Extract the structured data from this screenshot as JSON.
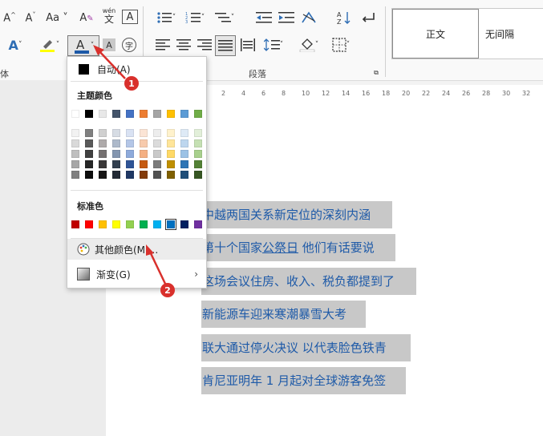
{
  "ribbon": {
    "row1_icons": [
      "A^",
      "A˅",
      "Aa",
      "A✎",
      "wén",
      "A"
    ],
    "wen_top": "wén",
    "wen_bottom": "文",
    "group_font_tail": "体",
    "group_paragraph": "段落",
    "styles": [
      "正文",
      "无间隔"
    ]
  },
  "ruler_ticks": [
    "2",
    "4",
    "6",
    "8",
    "10",
    "12",
    "14",
    "16",
    "18",
    "20",
    "22",
    "24",
    "26",
    "28",
    "30",
    "32"
  ],
  "menu": {
    "auto_label": "自动(A)",
    "theme_title": "主题颜色",
    "standard_title": "标准色",
    "more_colors": "其他颜色(M)...",
    "gradient": "渐变(G)"
  },
  "theme_top": [
    "#ffffff",
    "#000000",
    "#e8e8e8",
    "#44546a",
    "#4472c4",
    "#ed7d31",
    "#a5a5a5",
    "#ffc000",
    "#5b9bd5",
    "#70ad47"
  ],
  "theme_shades": [
    [
      "#f2f2f2",
      "#d9d9d9",
      "#bfbfbf",
      "#a6a6a6",
      "#808080"
    ],
    [
      "#808080",
      "#595959",
      "#404040",
      "#262626",
      "#0d0d0d"
    ],
    [
      "#d0d0d0",
      "#aeaaaa",
      "#757171",
      "#3a3838",
      "#171616"
    ],
    [
      "#d6dce4",
      "#adb9ca",
      "#8496b0",
      "#323f4f",
      "#222a35"
    ],
    [
      "#d9e2f3",
      "#b4c6e7",
      "#8eaadb",
      "#2f5496",
      "#1f3864"
    ],
    [
      "#fbe4d5",
      "#f7caac",
      "#f4b083",
      "#c55a11",
      "#833c0b"
    ],
    [
      "#ededed",
      "#dbdbdb",
      "#c9c9c9",
      "#7b7b7b",
      "#525252"
    ],
    [
      "#fff2cc",
      "#ffe599",
      "#ffd966",
      "#bf8f00",
      "#7f6000"
    ],
    [
      "#deeaf6",
      "#bdd6ee",
      "#9cc2e5",
      "#2e75b5",
      "#1f4e79"
    ],
    [
      "#e2efd9",
      "#c5e0b3",
      "#a8d08d",
      "#538135",
      "#375623"
    ]
  ],
  "standard_colors": [
    "#c00000",
    "#ff0000",
    "#ffc000",
    "#ffff00",
    "#92d050",
    "#00b050",
    "#00b0f0",
    "#0070c0",
    "#002060",
    "#7030a0"
  ],
  "doc_lines": [
    "中越两国关系新定位的深刻内涵",
    "第十个国家公祭日  他们有话要说",
    "这场会议住房、收入、税负都提到了",
    "新能源车迎来寒潮暴雪大考",
    "联大通过停火决议  以代表脸色铁青",
    "肯尼亚明年 1 月起对全球游客免签"
  ],
  "callouts": [
    "1",
    "2"
  ],
  "colors": {
    "accent_red": "#d9302c",
    "text_blue": "#1e5aa8",
    "selection_gray": "#c8c8c8"
  }
}
